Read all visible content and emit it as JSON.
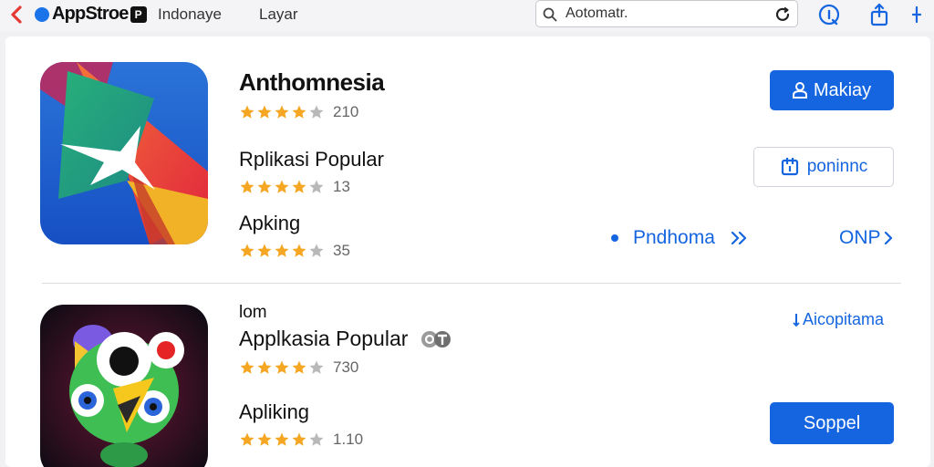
{
  "toolbar": {
    "brand": "AppStroe",
    "brand_badge": "P",
    "region": "Indonaye",
    "layar": "Layar",
    "search_text": "Aotomatr."
  },
  "apps": [
    {
      "title": "Anthomnesia",
      "title_rating": "210",
      "title_stars": 4,
      "sub1_name": "Rplikasi Popular",
      "sub1_rating": "13",
      "sub1_stars": 4,
      "sub2_name": "Apking",
      "sub2_rating": "35",
      "sub2_stars": 4,
      "primary_button": "Makiay",
      "outline_button": "poninnc",
      "link_left": "Pndhoma",
      "link_right": "ONP"
    },
    {
      "small_title": "lom",
      "name1": "Applkasia Popular",
      "rating1": "730",
      "stars1": 4,
      "name2": "Apliking",
      "rating2": "1.10",
      "stars2": 4,
      "top_link": "Aicopitama",
      "button": "Soppel"
    }
  ],
  "colors": {
    "accent": "#1565e0",
    "star": "#f5a623",
    "back_arrow": "#e53935"
  },
  "icons": [
    "back-arrow-icon",
    "search-icon",
    "refresh-icon",
    "info-icon",
    "share-icon",
    "more-icon"
  ]
}
